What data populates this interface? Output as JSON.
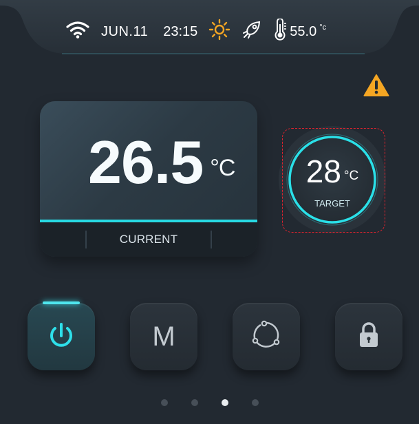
{
  "status": {
    "date": "JUN.11",
    "time": "23:15",
    "temperature": "55.0",
    "temperature_unit": "°c",
    "icons": [
      "wifi-icon",
      "sun-icon",
      "rocket-icon",
      "thermometer-icon"
    ]
  },
  "alert": {
    "icon": "warning-icon"
  },
  "current": {
    "value": "26.5",
    "unit": "°C",
    "label": "CURRENT"
  },
  "target": {
    "value": "28",
    "unit": "°C",
    "label": "TARGET"
  },
  "controls": [
    {
      "name": "power",
      "icon": "power-icon",
      "active": true
    },
    {
      "name": "mode",
      "icon_text": "M",
      "active": false
    },
    {
      "name": "cycle",
      "icon": "cycle-icon",
      "active": false
    },
    {
      "name": "lock",
      "icon": "lock-icon",
      "active": false
    }
  ],
  "pagination": {
    "total": 4,
    "current_page": 3
  },
  "colors": {
    "accent": "#28d9e3",
    "warning": "#f5a623",
    "background": "#232a31"
  }
}
